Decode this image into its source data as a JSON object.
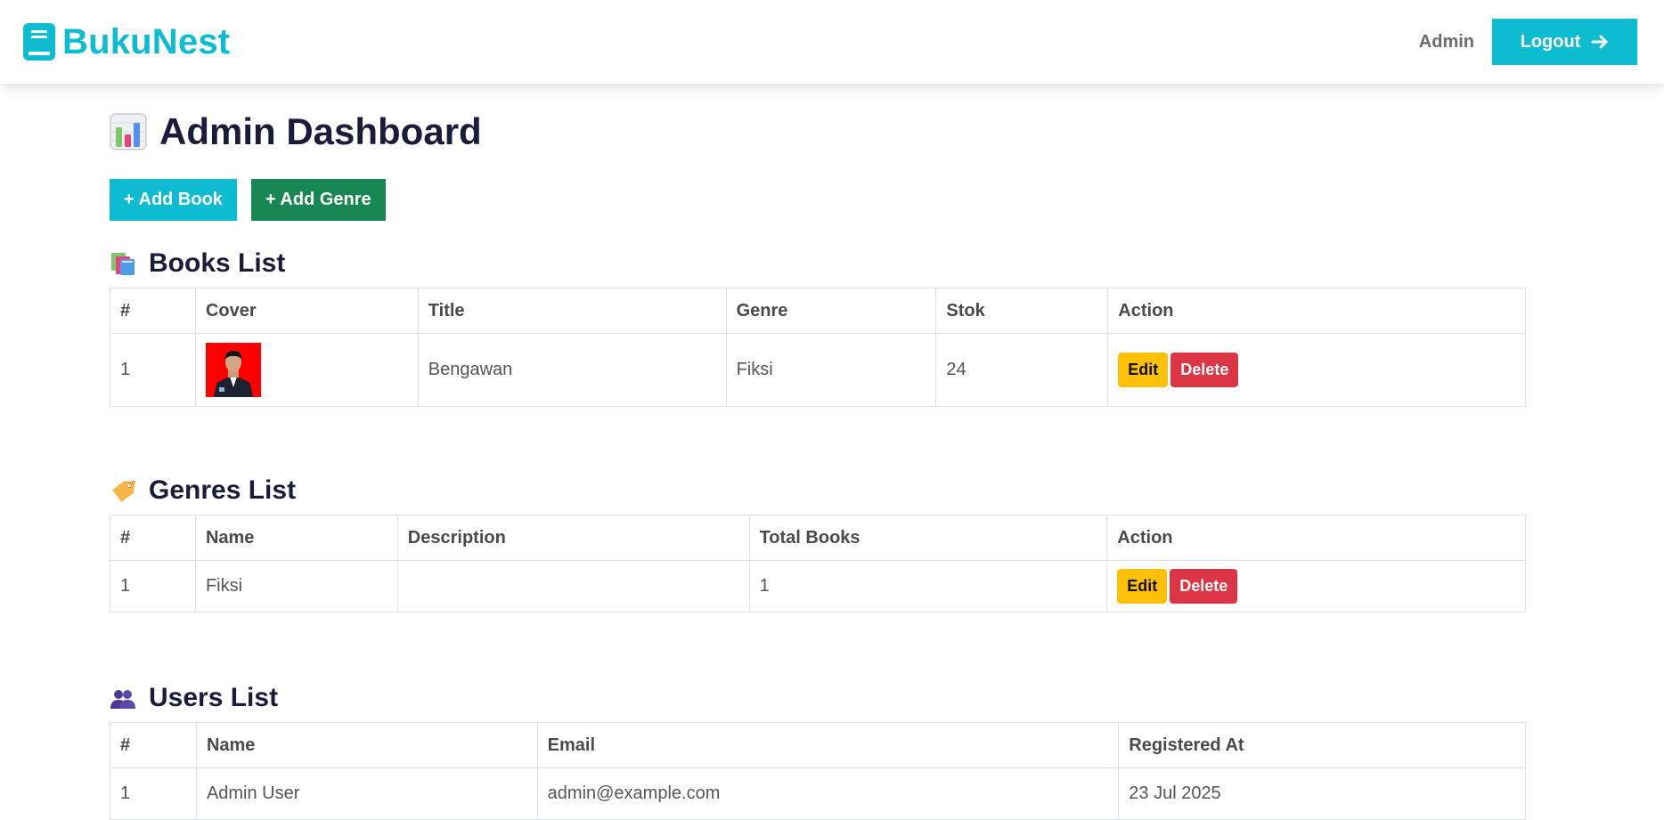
{
  "navbar": {
    "brand": "BukuNest",
    "user": "Admin",
    "logout_label": "Logout"
  },
  "page": {
    "title": "Admin Dashboard"
  },
  "actions": {
    "add_book": "+ Add Book",
    "add_genre": "+ Add Genre"
  },
  "books": {
    "title": "Books List",
    "headers": [
      "#",
      "Cover",
      "Title",
      "Genre",
      "Stok",
      "Action"
    ],
    "rows": [
      {
        "no": "1",
        "title": "Bengawan",
        "genre": "Fiksi",
        "stok": "24",
        "edit": "Edit",
        "delete": "Delete"
      }
    ]
  },
  "genres": {
    "title": "Genres List",
    "headers": [
      "#",
      "Name",
      "Description",
      "Total Books",
      "Action"
    ],
    "rows": [
      {
        "no": "1",
        "name": "Fiksi",
        "description": "",
        "total": "1",
        "edit": "Edit",
        "delete": "Delete"
      }
    ]
  },
  "users": {
    "title": "Users List",
    "headers": [
      "#",
      "Name",
      "Email",
      "Registered At"
    ],
    "rows": [
      {
        "no": "1",
        "name": "Admin User",
        "email": "admin@example.com",
        "registered": "23 Jul 2025"
      }
    ]
  },
  "colors": {
    "accent": "#0dbcd0",
    "success": "#198754",
    "warning": "#ffc107",
    "danger": "#dc3545",
    "heading": "#1b1b3a"
  },
  "icons": {
    "brand": "book-icon",
    "logout": "arrow-right-icon",
    "dashboard": "bar-chart-icon",
    "books": "books-icon",
    "genres": "label-tag-icon",
    "users": "users-icon"
  }
}
